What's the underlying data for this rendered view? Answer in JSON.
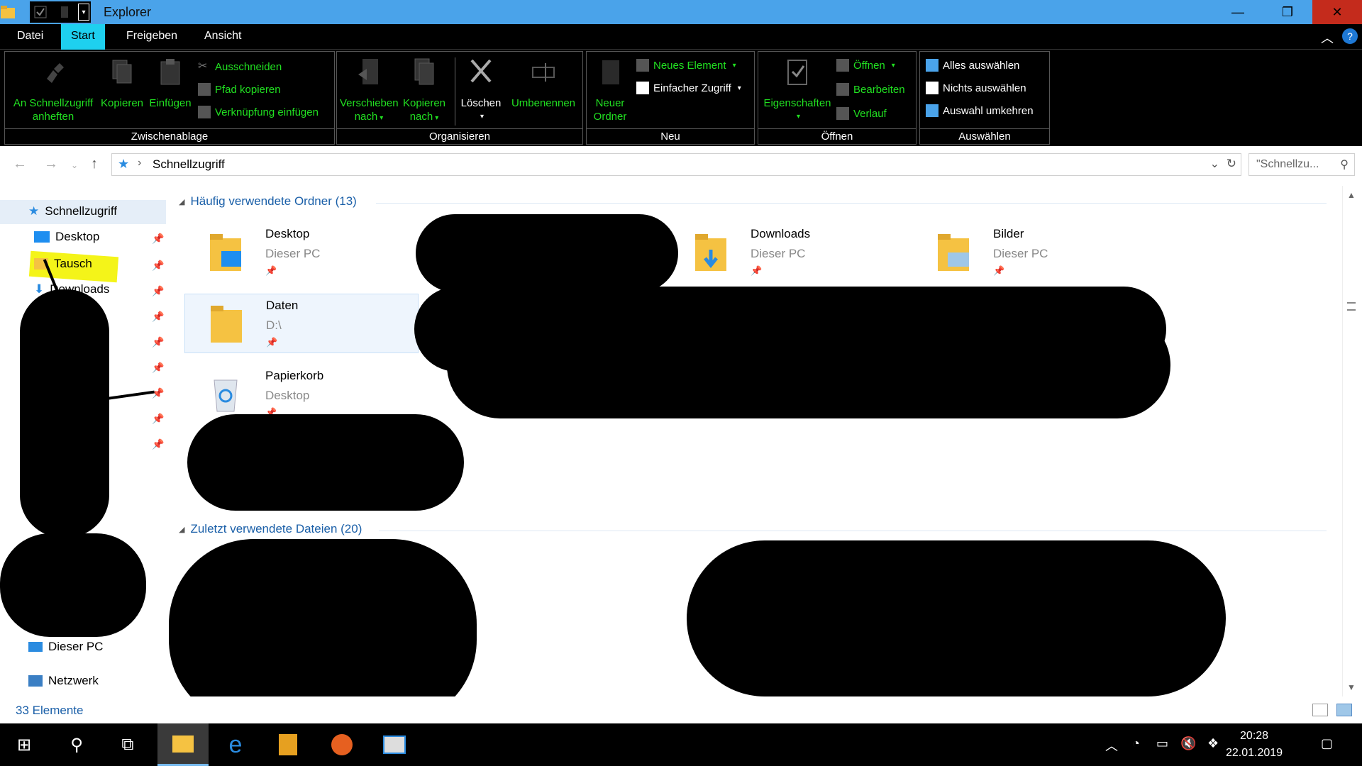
{
  "window": {
    "title": "Explorer",
    "controls": {
      "minimize": "—",
      "maximize": "❐",
      "close": "✕"
    }
  },
  "ribbon_tabs": [
    {
      "label": "Datei",
      "active": false
    },
    {
      "label": "Start",
      "active": true
    },
    {
      "label": "Freigeben",
      "active": false
    },
    {
      "label": "Ansicht",
      "active": false
    }
  ],
  "ribbon": {
    "clipboard": {
      "label": "Zwischenablage",
      "pin": "An Schnellzugriff\nanheften",
      "pin_l1": "An Schnellzugriff",
      "pin_l2": "anheften",
      "copy": "Kopieren",
      "paste": "Einfügen",
      "cut": "Ausschneiden",
      "copy_path": "Pfad kopieren",
      "paste_shortcut": "Verknüpfung einfügen"
    },
    "organize": {
      "label": "Organisieren",
      "move_l1": "Verschieben",
      "move_l2": "nach",
      "copyto_l1": "Kopieren",
      "copyto_l2": "nach",
      "delete": "Löschen",
      "rename": "Umbenennen"
    },
    "new": {
      "label": "Neu",
      "new_folder_l1": "Neuer",
      "new_folder_l2": "Ordner",
      "new_item": "Neues Element",
      "easy_access": "Einfacher Zugriff"
    },
    "open": {
      "label": "Öffnen",
      "properties": "Eigenschaften",
      "open": "Öffnen",
      "edit": "Bearbeiten",
      "history": "Verlauf"
    },
    "select": {
      "label": "Auswählen",
      "select_all": "Alles auswählen",
      "select_none": "Nichts auswählen",
      "invert": "Auswahl umkehren"
    }
  },
  "address": {
    "path": "Schnellzugriff",
    "search_placeholder": "\"Schnellzu..."
  },
  "navpane": {
    "items": [
      {
        "label": "Schnellzugriff"
      },
      {
        "label": "Desktop"
      },
      {
        "label": "Tausch"
      },
      {
        "label": "Downloads"
      },
      {
        "label": "Dieser PC"
      },
      {
        "label": "Netzwerk"
      }
    ]
  },
  "content": {
    "frequent_header": "Häufig verwendete Ordner (13)",
    "recent_header": "Zuletzt verwendete Dateien (20)",
    "tiles": [
      {
        "name": "Desktop",
        "location": "Dieser PC"
      },
      {
        "name": "Downloads",
        "location": "Dieser PC"
      },
      {
        "name": "Bilder",
        "location": "Dieser PC"
      },
      {
        "name": "Daten",
        "location": "D:\\"
      },
      {
        "name": "Papierkorb",
        "location": "Desktop"
      }
    ]
  },
  "status": {
    "count": "33 Elemente"
  },
  "taskbar": {
    "time": "20:28",
    "date": "22.01.2019"
  },
  "colors": {
    "accent": "#1ed0ef",
    "ribbon_text": "#21e021",
    "titlebar": "#4aa3ea"
  }
}
